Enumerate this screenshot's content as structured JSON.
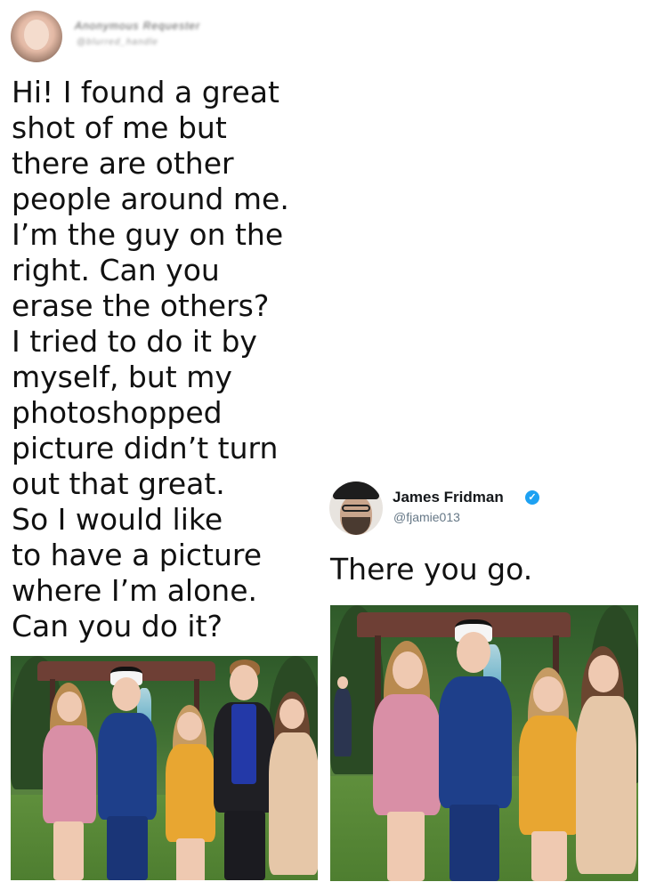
{
  "left_post": {
    "name": "Anonymous Requester",
    "handle": "@blurred_handle",
    "message": "Hi! I found a great\nshot of me but\nthere are other\npeople around me.\nI’m the guy on the\nright. Can you\nerase the others?\nI tried to do it by\nmyself, but my\nphotoshopped\npicture didn’t turn\nout that great.\nSo I would like\nto have a picture\nwhere I’m alone.\nCan you do it?"
  },
  "right_post": {
    "name": "James Fridman",
    "handle": "@fjamie013",
    "verified_icon": "✓",
    "message": "There you go."
  },
  "colors": {
    "verified_blue": "#1da1f2",
    "handle_gray": "#657786",
    "text": "#111111"
  },
  "icons": [
    "avatar-photo",
    "verified-badge-icon"
  ]
}
